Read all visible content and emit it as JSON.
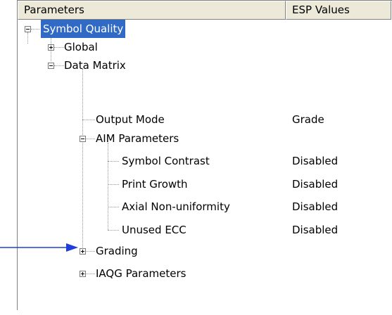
{
  "header": {
    "col_parameters": "Parameters",
    "col_values": "ESP Values"
  },
  "tree": {
    "root": {
      "label": "Symbol Quality"
    },
    "global": {
      "label": "Global"
    },
    "data_matrix": {
      "label": "Data Matrix"
    },
    "output_mode": {
      "label": "Output Mode",
      "value": "Grade"
    },
    "aim_parameters": {
      "label": "AIM Parameters"
    },
    "symbol_contrast": {
      "label": "Symbol Contrast",
      "value": "Disabled"
    },
    "print_growth": {
      "label": "Print Growth",
      "value": "Disabled"
    },
    "axial_nonuniformity": {
      "label": "Axial Non-uniformity",
      "value": "Disabled"
    },
    "unused_ecc": {
      "label": "Unused ECC",
      "value": "Disabled"
    },
    "grading": {
      "label": "Grading"
    },
    "iaqg_parameters": {
      "label": "IAQG Parameters"
    }
  },
  "colors": {
    "selection": "#316ac5",
    "arrow": "#1f3fd6",
    "header": "#ece9d8"
  },
  "icons": {
    "expand": "plus-box",
    "collapse": "minus-box"
  }
}
